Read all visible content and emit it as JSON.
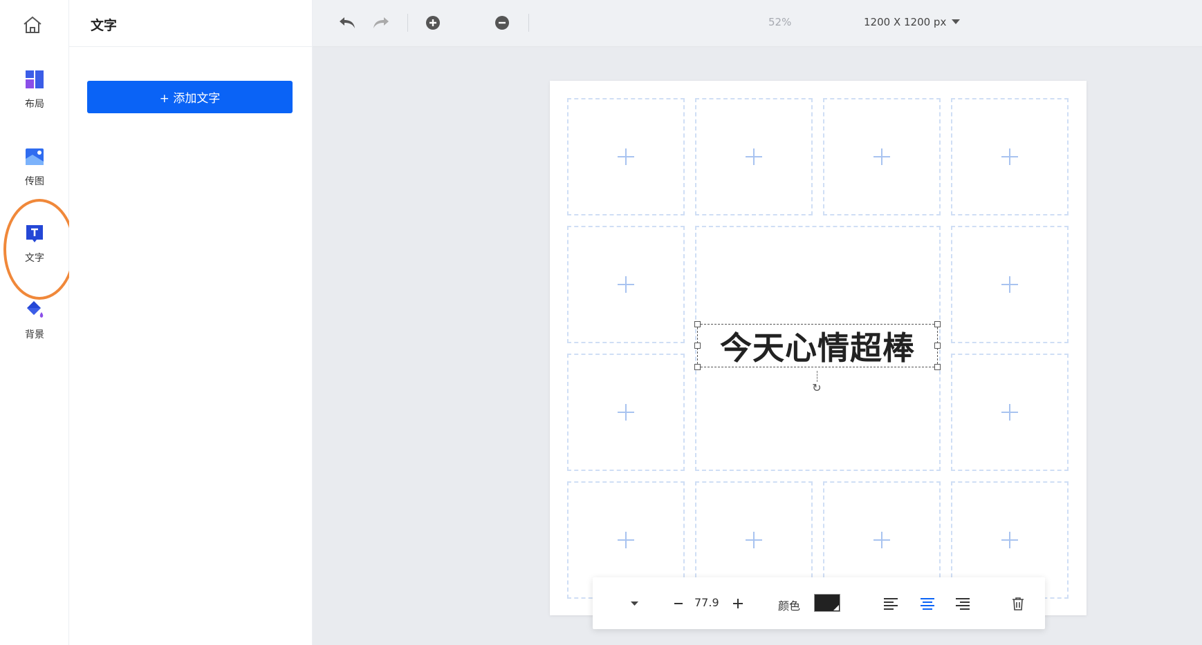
{
  "rail": {
    "home_icon": "home-icon",
    "items": [
      {
        "label": "布局",
        "icon": "layout-icon"
      },
      {
        "label": "传图",
        "icon": "upload-image-icon"
      },
      {
        "label": "文字",
        "icon": "text-icon"
      },
      {
        "label": "背景",
        "icon": "background-fill-icon"
      }
    ]
  },
  "panel": {
    "title": "文字",
    "add_button": "+ 添加文字"
  },
  "toolbar": {
    "zoom": "52%",
    "canvas_size": "1200 X 1200 px"
  },
  "canvas": {
    "text": "今天心情超棒"
  },
  "propbar": {
    "font_size": "77.9",
    "color_label": "颜色",
    "color_value": "#222222"
  },
  "colors": {
    "accent": "#0a63f6",
    "annotation": "#f0883a",
    "placeholder_border": "#cfdef5"
  }
}
